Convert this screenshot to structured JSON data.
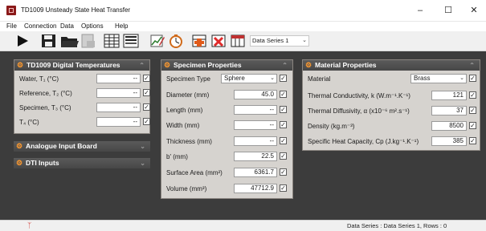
{
  "window": {
    "title": "TD1009 Unsteady State Heat Transfer"
  },
  "menu": [
    "File",
    "Connection",
    "Data",
    "Options",
    "Help"
  ],
  "toolbar": {
    "data_series_selected": "Data Series 1"
  },
  "panels": {
    "digital": {
      "title": "TD1009 Digital Temperatures",
      "rows": [
        {
          "label": "Water, T₁ (°C)",
          "value": "--",
          "checked": true
        },
        {
          "label": "Reference, T₂ (°C)",
          "value": "--",
          "checked": true
        },
        {
          "label": "Specimen, T₃ (°C)",
          "value": "--",
          "checked": true
        },
        {
          "label": "T₄ (°C)",
          "value": "--",
          "checked": true
        }
      ]
    },
    "analogue": {
      "title": "Analogue Input Board"
    },
    "dti": {
      "title": "DTI Inputs"
    },
    "specimen": {
      "title": "Specimen Properties",
      "type_label": "Specimen Type",
      "type_value": "Sphere",
      "rows": [
        {
          "label": "Diameter (mm)",
          "value": "45.0",
          "checked": true
        },
        {
          "label": "Length (mm)",
          "value": "--",
          "checked": true
        },
        {
          "label": "Width (mm)",
          "value": "--",
          "checked": true
        },
        {
          "label": "Thickness (mm)",
          "value": "--",
          "checked": true
        },
        {
          "label": "b' (mm)",
          "value": "22.5",
          "checked": true
        },
        {
          "label": "Surface Area (mm²)",
          "value": "6361.7",
          "checked": true
        },
        {
          "label": "Volume (mm³)",
          "value": "47712.9",
          "checked": true
        }
      ]
    },
    "material": {
      "title": "Material Properties",
      "material_label": "Material",
      "material_value": "Brass",
      "rows": [
        {
          "label": "Thermal Conductivity, k (W.m⁻¹.K⁻¹)",
          "value": "121",
          "checked": true
        },
        {
          "label": "Thermal Diffusivity, α (x10⁻⁶ m².s⁻¹)",
          "value": "37",
          "checked": true
        },
        {
          "label": "Density (kg.m⁻³)",
          "value": "8500",
          "checked": true
        },
        {
          "label": "Specific Heat Capacity, Cp (J.kg⁻¹.K⁻¹)",
          "value": "385",
          "checked": true
        }
      ]
    }
  },
  "status": {
    "text": "Data Series : Data Series 1,  Rows : 0"
  },
  "icons": [
    "play-icon",
    "save-icon",
    "open-folder-icon",
    "export-icon",
    "table-icon",
    "chart-icon",
    "edit-chart-icon",
    "timer-icon",
    "add-series-icon",
    "delete-series-icon",
    "series-table-icon",
    "gear-icon",
    "chevron-up-icon",
    "chevron-down-icon",
    "usb-icon"
  ],
  "colors": {
    "panel_header": "#4d4d4d",
    "panel_body": "#d6d3cf",
    "accent": "#ff9a2e",
    "workarea": "#3c3c3c"
  }
}
